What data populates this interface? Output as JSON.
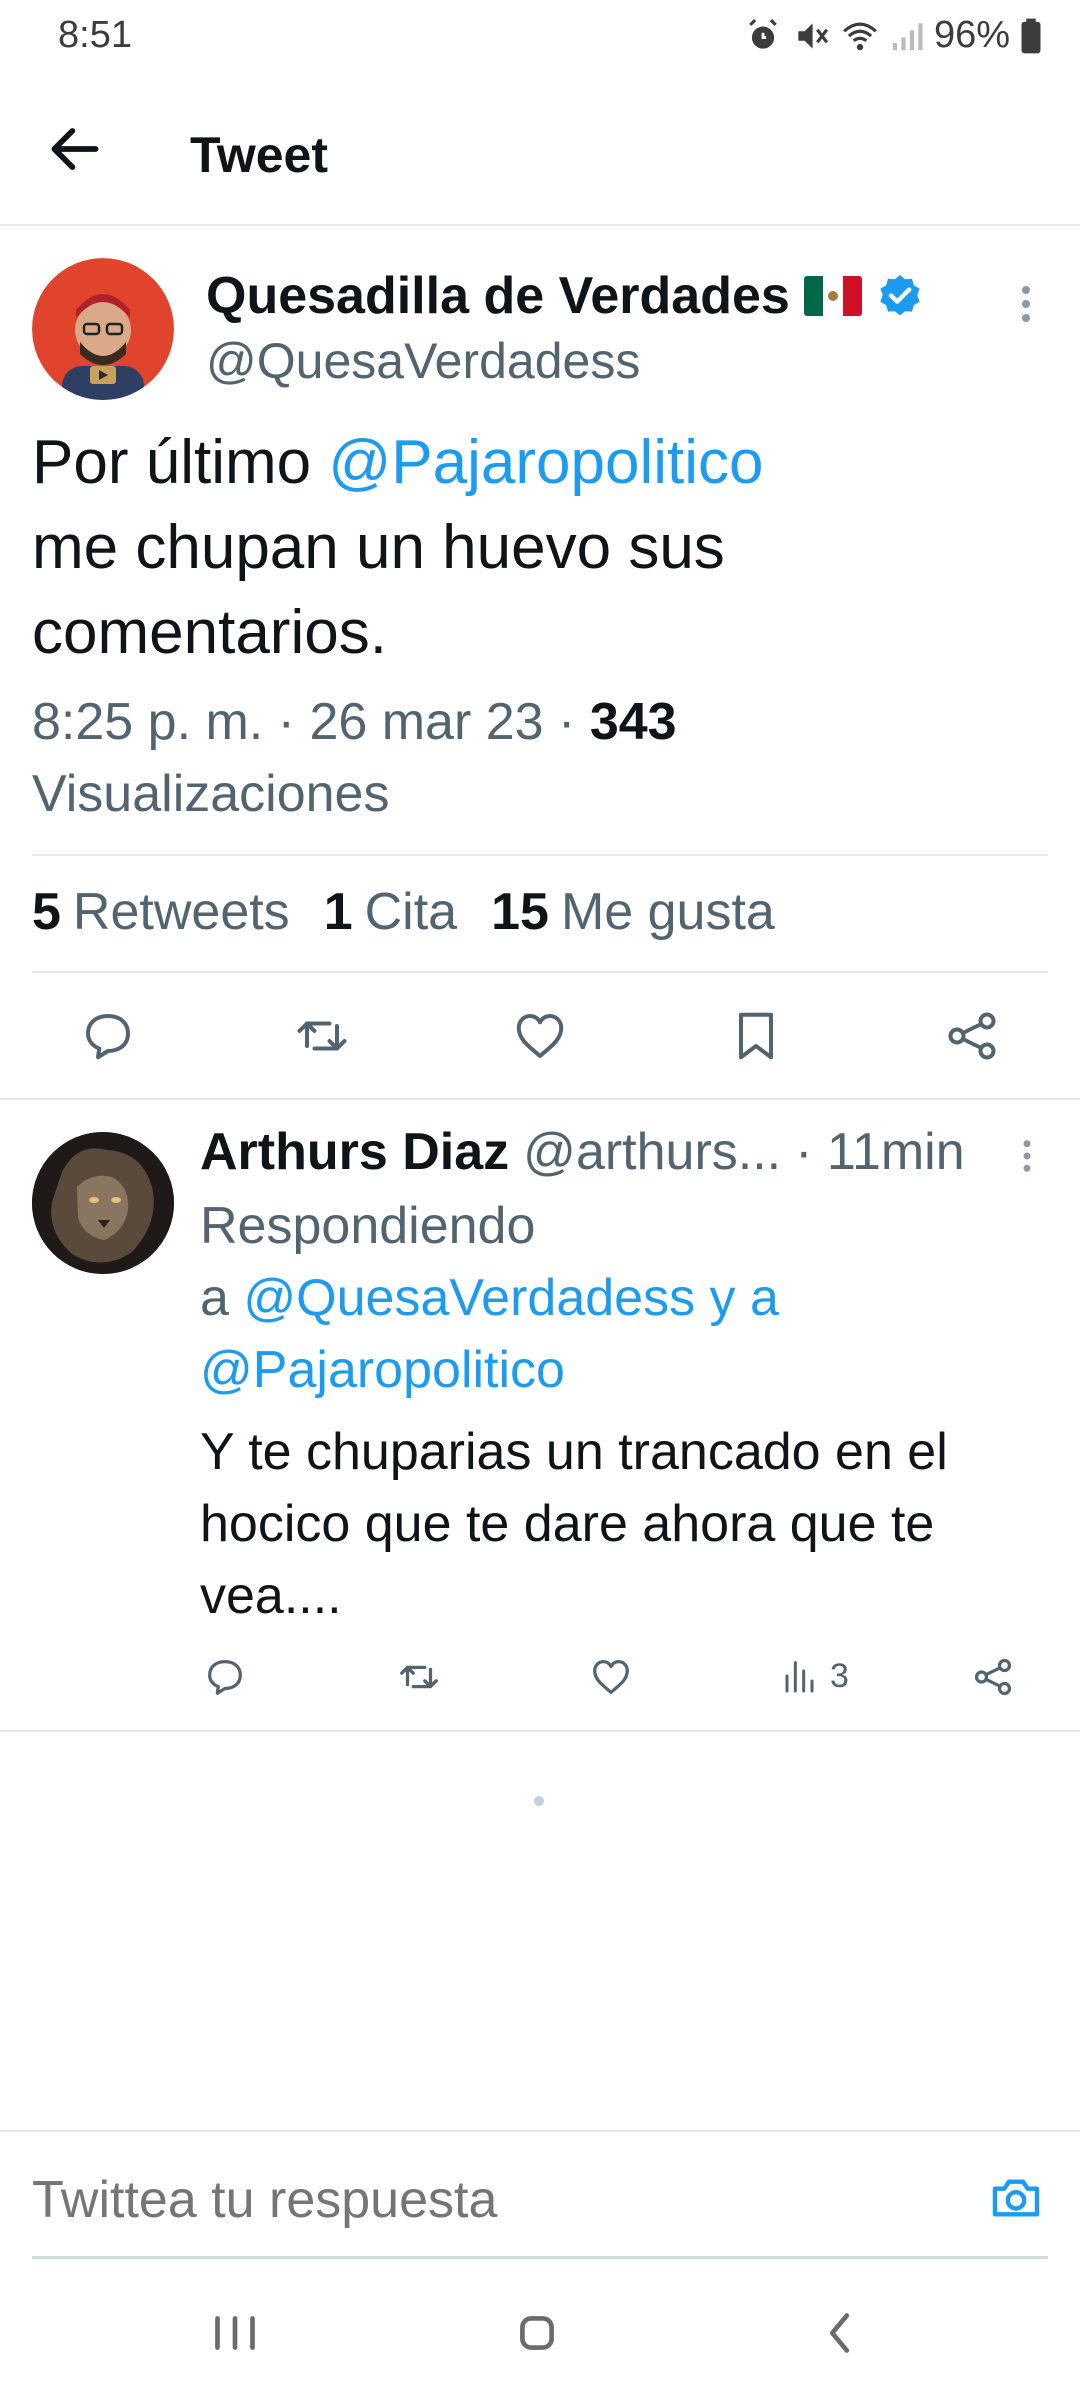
{
  "status_bar": {
    "time": "8:51",
    "battery": "96%",
    "icons": [
      "alarm-icon",
      "mute-icon",
      "wifi-icon",
      "signal-icon",
      "battery-icon"
    ]
  },
  "header": {
    "title": "Tweet",
    "back_icon": "back-arrow-icon"
  },
  "tweet": {
    "author_name": "Quesadilla de Verdades",
    "author_handle": "@QuesaVerdadess",
    "text_mention": "@Pajaropolitico",
    "text_before": "Por último ",
    "text_after": "me chupan un huevo sus comentarios.",
    "time": "8:25 p. m.",
    "date": "26 mar 23",
    "views_count": "343",
    "views_label": "Visualizaciones",
    "stats": {
      "retweets_count": "5",
      "retweets_label": "Retweets",
      "quotes_count": "1",
      "quotes_label": "Cita",
      "likes_count": "15",
      "likes_label": "Me gusta"
    },
    "actions": [
      "reply-icon",
      "retweet-icon",
      "like-icon",
      "bookmark-icon",
      "share-icon"
    ]
  },
  "reply": {
    "author_name": "Arthurs Diaz",
    "author_handle": "@arthurs...",
    "time": "· 11min",
    "replying_label": "Respondiendo",
    "replying_a": "a ",
    "replying_to_1": "@QuesaVerdadess",
    "replying_and": " y a",
    "replying_to_2": "@Pajaropolitico",
    "text": "Y te chuparias un trancado en el hocico que te dare ahora que te vea....",
    "views_count": "3"
  },
  "compose": {
    "placeholder": "Twittea tu respuesta"
  },
  "colors": {
    "accent": "#1d9bf0",
    "text_primary": "#0f1419",
    "text_secondary": "#536471"
  }
}
